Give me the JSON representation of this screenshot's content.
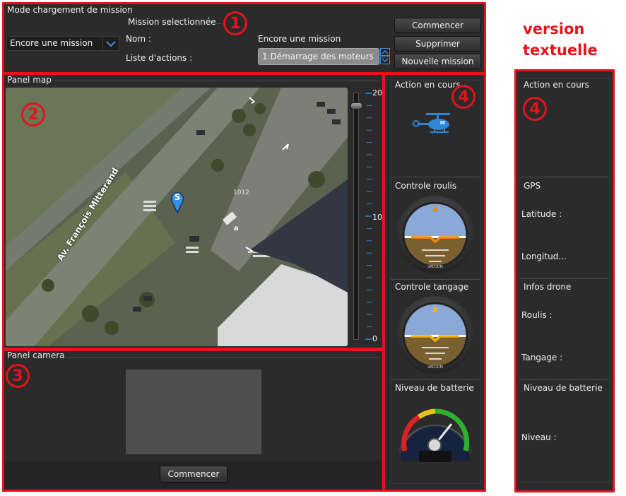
{
  "annotations": {
    "one": "1",
    "two": "2",
    "three": "3",
    "four": "4",
    "four_text": "4",
    "version_line1": "version",
    "version_line2": "textuelle"
  },
  "mission_panel": {
    "mode_title": "Mode chargement de mission",
    "mission_select_value": "Encore une mission",
    "selected_title": "Mission selectionnée",
    "nom_label": "Nom :",
    "nom_value": "Encore une mission",
    "actions_label": "Liste d'actions :",
    "actions_value": "1.Démarrage des moteurs",
    "btn_start": "Commencer",
    "btn_delete": "Supprimer",
    "btn_new": "Nouvelle mission"
  },
  "map_panel": {
    "title": "Panel map",
    "street_label": "Av. François Mitterand",
    "marker_letter": "S",
    "zoom_max": "20",
    "zoom_mid": "10",
    "zoom_min": "0",
    "zoom_level": 20,
    "street_number": "1012",
    "road_marker": "a"
  },
  "camera_panel": {
    "title": "Panel camera",
    "btn_start": "Commencer"
  },
  "instruments_panel": {
    "current_action": "Action en cours",
    "roll_title": "Controle roulis",
    "pitch_title": "Controle tangage",
    "battery_title": "Niveau de batterie",
    "attitude_text": "VACUUM"
  },
  "text_panel": {
    "current_action": "Action en cours",
    "gps_title": "GPS",
    "latitude": "Latitude :",
    "longitude": "Longitud...",
    "drone_title": "Infos drone",
    "roll": "Roulis :",
    "pitch": "Tangage :",
    "battery_title": "Niveau de batterie",
    "level": "Niveau :"
  },
  "colors": {
    "accent_red": "#e8121b",
    "panel_bg": "#2b2b2b",
    "scale_blue": "#2e86d6"
  }
}
